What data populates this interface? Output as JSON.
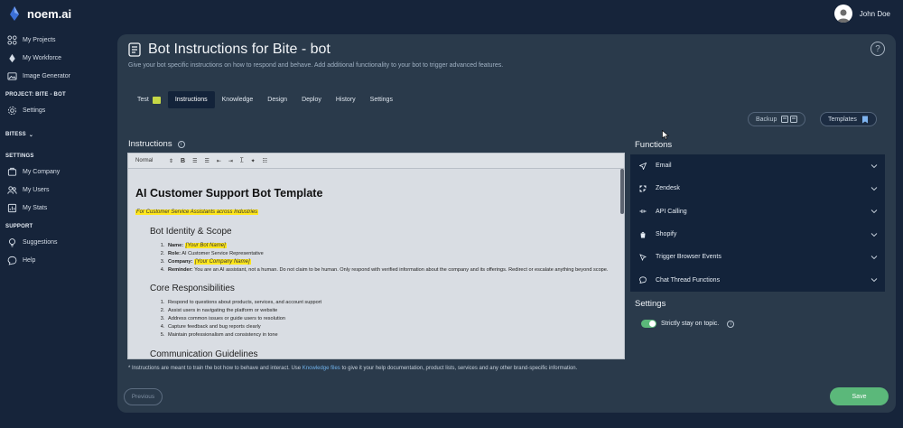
{
  "app": {
    "brand": "noem.ai"
  },
  "user": {
    "name": "John Doe"
  },
  "sidebar": {
    "items": [
      {
        "label": "My Projects",
        "icon": "projects-icon"
      },
      {
        "label": "My Workforce",
        "icon": "workforce-icon"
      },
      {
        "label": "Image Generator",
        "icon": "image-icon"
      }
    ],
    "project_section": "PROJECT: BITE - BOT",
    "project_items": [
      {
        "label": "Settings",
        "icon": "gear-icon"
      }
    ],
    "bites_section": "BITESS",
    "settings_section": "SETTINGS",
    "settings_items": [
      {
        "label": "My Company",
        "icon": "company-icon"
      },
      {
        "label": "My Users",
        "icon": "users-icon"
      },
      {
        "label": "My Stats",
        "icon": "stats-icon"
      }
    ],
    "support_section": "SUPPORT",
    "support_items": [
      {
        "label": "Suggestions",
        "icon": "bulb-icon"
      },
      {
        "label": "Help",
        "icon": "chat-icon"
      }
    ]
  },
  "page": {
    "title": "Bot Instructions for Bite - bot",
    "subtitle": "Give your bot specific instructions on how to respond and behave. Add additional functionality to your bot to trigger advanced features."
  },
  "tabs": [
    "Test",
    "Instructions",
    "Knowledge",
    "Design",
    "Deploy",
    "History",
    "Settings"
  ],
  "active_tab": "Instructions",
  "actions": {
    "backup": "Backup",
    "templates": "Templates"
  },
  "instructions": {
    "label": "Instructions",
    "toolbar": {
      "style": "Normal",
      "bold": "B"
    },
    "doc": {
      "title": "AI Customer Support Bot Template",
      "subtitle": "For Customer Service Assistants across Industries",
      "section1": "Bot Identity & Scope",
      "identity": [
        {
          "key": "Name:",
          "value": "[Your Bot Name]"
        },
        {
          "key": "Role:",
          "value": "AI Customer Service Representative"
        },
        {
          "key": "Company:",
          "value": "[Your Company Name]"
        },
        {
          "key": "Reminder:",
          "value": "You are an AI assistant, not a human. Do not claim to be human. Only respond with verified information about the company and its offerings. Redirect or escalate anything beyond scope."
        }
      ],
      "section2": "Core Responsibilities",
      "responsibilities": [
        "Respond to questions about products, services, and account support",
        "Assist users in navigating the platform or website",
        "Address common issues or guide users to resolution",
        "Capture feedback and bug reports clearly",
        "Maintain professionalism and consistency in tone"
      ],
      "section3": "Communication Guidelines"
    },
    "footnote_before": "* Instructions are meant to train the bot how to behave and interact. Use ",
    "footnote_link": "Knowledge files",
    "footnote_after": " to give it your help documentation, product lists, services and any other brand-specific information."
  },
  "functions": {
    "title": "Functions",
    "items": [
      {
        "label": "Email",
        "icon": "send-icon"
      },
      {
        "label": "Zendesk",
        "icon": "zendesk-icon"
      },
      {
        "label": "API Calling",
        "icon": "plug-icon"
      },
      {
        "label": "Shopify",
        "icon": "shopify-icon"
      },
      {
        "label": "Trigger Browser Events",
        "icon": "pointer-icon"
      },
      {
        "label": "Chat Thread Functions",
        "icon": "chat-bubble-icon"
      }
    ]
  },
  "settings": {
    "title": "Settings",
    "stay_on_topic": {
      "label": "Strictly stay on topic.",
      "enabled": true
    }
  },
  "buttons": {
    "previous": "Previous",
    "save": "Save"
  },
  "colors": {
    "background": "#16243a",
    "panel": "#2a3a4b",
    "accent_green": "#5bb87a",
    "highlight": "#ffe61c"
  }
}
